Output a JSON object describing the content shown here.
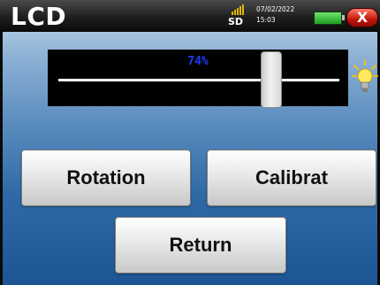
{
  "header": {
    "title": "LCD",
    "sd_label": "SD",
    "date": "07/02/2022",
    "time": "15:03",
    "close_label": "X",
    "battery_color": "#28b428",
    "close_color": "#c2160a"
  },
  "brightness": {
    "percent_label": "74%",
    "level": 0.74,
    "percent_color": "#1e3cff"
  },
  "buttons": {
    "rotation_label": "Rotation",
    "calibrate_label": "Calibrat",
    "return_label": "Return"
  },
  "icons": {
    "sd": "sd-card-icon",
    "battery": "battery-icon",
    "close": "close-icon",
    "bulb": "lightbulb-icon"
  }
}
